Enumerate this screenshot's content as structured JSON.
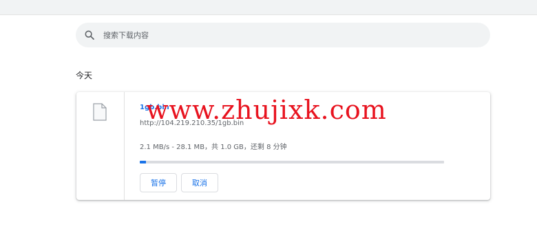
{
  "search": {
    "placeholder": "搜索下载内容"
  },
  "section": {
    "title": "今天"
  },
  "download": {
    "file_name": "1gb.bin",
    "url": "http://104.219.210.35/1gb.bin",
    "status": "2.1 MB/s - 28.1 MB，共 1.0 GB，还剩 8 分钟",
    "progress": 0.02,
    "pause_label": "暂停",
    "cancel_label": "取消"
  },
  "watermark": "www.zhujixk.com",
  "colors": {
    "accent": "#1a73e8",
    "watermark": "#e8131f",
    "progress_track": "#dadce0"
  }
}
